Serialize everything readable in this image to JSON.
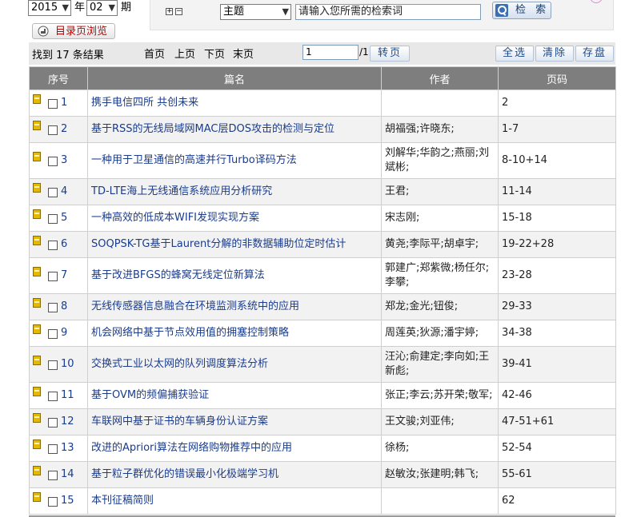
{
  "filters": {
    "year": "2015",
    "year_label": "年",
    "issue": "02",
    "issue_label": "期",
    "catalog_button": "目录页浏览"
  },
  "search": {
    "field": "主题",
    "placeholder": "请输入您所需的检索词",
    "button": "检 索"
  },
  "toolbar": {
    "result_count": "找到 17 条结果",
    "first": "首页",
    "prev": "上页",
    "next": "下页",
    "last": "末页",
    "page_value": "1",
    "page_total": "/1",
    "go": "转页",
    "select_all": "全选",
    "clear": "清除",
    "save": "存盘"
  },
  "table": {
    "headers": [
      "序号",
      "篇名",
      "作者",
      "页码"
    ],
    "rows": [
      {
        "no": "1",
        "title": "携手电信四所 共创未来",
        "author": "",
        "pages": "2"
      },
      {
        "no": "2",
        "title": "基于RSS的无线局域网MAC层DOS攻击的检测与定位",
        "author": "胡福强;许晓东;",
        "pages": "1-7"
      },
      {
        "no": "3",
        "title": "一种用于卫星通信的高速并行Turbo译码方法",
        "author": "刘解华;华韵之;燕丽;刘斌彬;",
        "pages": "8-10+14"
      },
      {
        "no": "4",
        "title": "TD-LTE海上无线通信系统应用分析研究",
        "author": "王君;",
        "pages": "11-14"
      },
      {
        "no": "5",
        "title": "一种高效的低成本WIFI发现实现方案",
        "author": "宋志刚;",
        "pages": "15-18"
      },
      {
        "no": "6",
        "title": "SOQPSK-TG基于Laurent分解的非数据辅助位定时估计",
        "author": "黄尧;李际平;胡卓宇;",
        "pages": "19-22+28"
      },
      {
        "no": "7",
        "title": "基于改进BFGS的蜂窝无线定位新算法",
        "author": "郭建广;郑紫微;杨任尔;李攀;",
        "pages": "23-28"
      },
      {
        "no": "8",
        "title": "无线传感器信息融合在环境监测系统中的应用",
        "author": "郑龙;金光;钮俊;",
        "pages": "29-33"
      },
      {
        "no": "9",
        "title": "机会网络中基于节点效用值的拥塞控制策略",
        "author": "周莲英;狄源;潘宇婷;",
        "pages": "34-38"
      },
      {
        "no": "10",
        "title": "交换式工业以太网的队列调度算法分析",
        "author": "汪沁;俞建定;李向如;王新彪;",
        "pages": "39-41"
      },
      {
        "no": "11",
        "title": "基于OVM的频偏捕获验证",
        "author": "张正;李云;苏开荣;敬军;",
        "pages": "42-46"
      },
      {
        "no": "12",
        "title": "车联网中基于证书的车辆身份认证方案",
        "author": "王文骏;刘亚伟;",
        "pages": "47-51+61"
      },
      {
        "no": "13",
        "title": "改进的Apriori算法在网络购物推荐中的应用",
        "author": "徐杨;",
        "pages": "52-54"
      },
      {
        "no": "14",
        "title": "基于粒子群优化的错误最小化极端学习机",
        "author": "赵敏汝;张建明;韩飞;",
        "pages": "55-61"
      },
      {
        "no": "15",
        "title": "本刊征稿简则",
        "author": "",
        "pages": "62"
      }
    ]
  }
}
